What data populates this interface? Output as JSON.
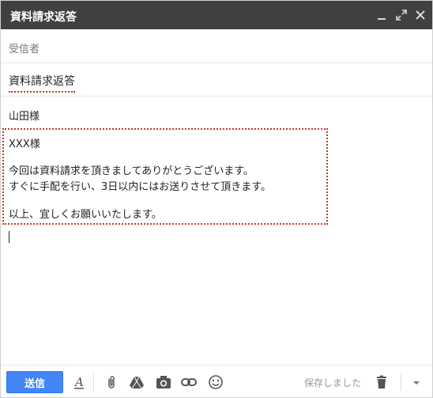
{
  "window": {
    "title": "資料請求返答"
  },
  "recipients": {
    "label": "受信者"
  },
  "subject": {
    "value": "資料請求返答"
  },
  "body": {
    "greeting": "山田様",
    "lines": [
      "XXX様",
      "今回は資料請求を頂きましてありがとうございます。",
      "すぐに手配を行い、3日以内にはお送りさせて頂きます。",
      "以上、宜しくお願いいたします。"
    ]
  },
  "toolbar": {
    "send_label": "送信",
    "saved_status": "保存しました"
  },
  "colors": {
    "titlebar": "#404040",
    "send": "#4285f4",
    "highlight": "#c53929"
  },
  "icons": [
    "minimize-icon",
    "popout-icon",
    "close-icon",
    "formatting-icon",
    "attach-icon",
    "drive-icon",
    "photo-icon",
    "link-icon",
    "emoji-icon",
    "trash-icon",
    "more-options-icon"
  ]
}
